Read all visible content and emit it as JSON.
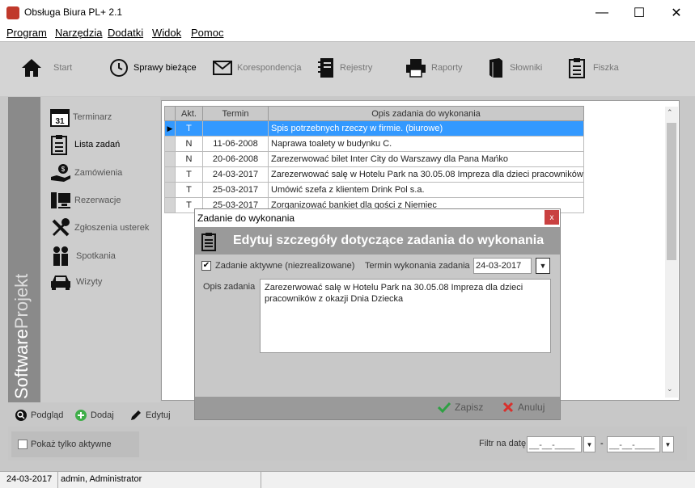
{
  "window": {
    "title": "Obsługa Biura PL+ 2.1",
    "minimize": "—",
    "maximize": "☐",
    "close": "✕"
  },
  "menu": [
    "Program",
    "Narzędzia",
    "Dodatki",
    "Widok",
    "Pomoc"
  ],
  "toolbar": [
    {
      "label": "Start",
      "icon": "house-icon"
    },
    {
      "label": "Sprawy bieżące",
      "icon": "clock-icon",
      "active": true
    },
    {
      "label": "Korespondencja",
      "icon": "envelope-icon"
    },
    {
      "label": "Rejestry",
      "icon": "notebook-icon"
    },
    {
      "label": "Raporty",
      "icon": "printer-icon"
    },
    {
      "label": "Słowniki",
      "icon": "book-icon"
    },
    {
      "label": "Fiszka",
      "icon": "clipboard-icon"
    }
  ],
  "brand": {
    "text_a": "Software",
    "text_b": "Projekt"
  },
  "sidebar": [
    {
      "label": "Terminarz",
      "icon": "calendar-icon"
    },
    {
      "label": "Lista zadań",
      "icon": "checklist-icon",
      "active": true
    },
    {
      "label": "Zamówienia",
      "icon": "money-hand-icon"
    },
    {
      "label": "Rezerwacje",
      "icon": "computer-icon"
    },
    {
      "label": "Zgłoszenia usterek",
      "icon": "tools-icon"
    },
    {
      "label": "Spotkania",
      "icon": "people-icon"
    },
    {
      "label": "Wizyty",
      "icon": "car-icon"
    }
  ],
  "grid": {
    "columns": [
      "Akt.",
      "Termin",
      "Opis zadania do wykonania"
    ],
    "rows": [
      {
        "akt": "T",
        "termin": "",
        "opis": "Spis potrzebnych rzeczy w firmie. (biurowe)"
      },
      {
        "akt": "N",
        "termin": "11-06-2008",
        "opis": "Naprawa toalety w budynku C."
      },
      {
        "akt": "N",
        "termin": "20-06-2008",
        "opis": "Zarezerwować bilet Inter City do Warszawy dla Pana Mańko"
      },
      {
        "akt": "T",
        "termin": "24-03-2017",
        "opis": "Zarezerwować salę w Hotelu Park na 30.05.08 Impreza dla dzieci pracowników"
      },
      {
        "akt": "T",
        "termin": "25-03-2017",
        "opis": "Umówić szefa z klientem Drink Pol s.a."
      },
      {
        "akt": "T",
        "termin": "25-03-2017",
        "opis": "Zorganizować bankiet dla gości z Niemiec"
      }
    ]
  },
  "bottom_buttons": [
    {
      "label": "Podgląd",
      "icon": "magnifier-icon"
    },
    {
      "label": "Dodaj",
      "icon": "plus-icon"
    },
    {
      "label": "Edytuj",
      "icon": "pencil-icon"
    }
  ],
  "filter": {
    "checkbox_label": "Pokaż tylko aktywne",
    "date_label": "Filtr na datę",
    "date_from": "__-__-____",
    "date_sep": "-",
    "date_to": "__-__-____"
  },
  "status": {
    "date": "24-03-2017",
    "user": "admin, Administrator"
  },
  "dialog": {
    "title": "Zadanie do wykonania",
    "close": "x",
    "heading": "Edytuj szczegóły dotyczące zadania do wykonania",
    "active_label": "Zadanie aktywne (niezrealizowane)",
    "deadline_label": "Termin wykonania zadania",
    "deadline_value": "24-03-2017",
    "desc_label": "Opis zadania",
    "desc_value": "Zarezerwować salę w Hotelu Park na 30.05.08 Impreza dla dzieci pracowników z okazji Dnia Dziecka",
    "save": "Zapisz",
    "cancel": "Anuluj"
  },
  "colors": {
    "selection": "#3399ff",
    "save": "#2ea043",
    "cancel": "#d9302c"
  }
}
